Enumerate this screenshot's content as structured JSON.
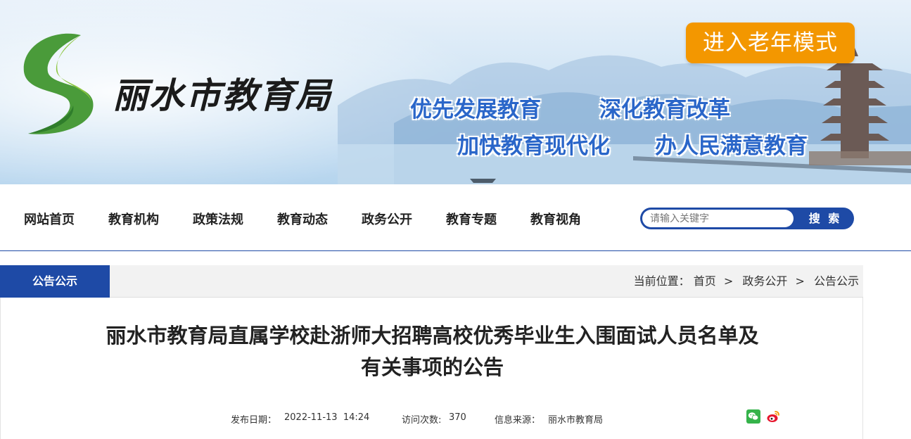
{
  "header": {
    "site_title": "丽水市教育局",
    "slogans": [
      "优先发展教育",
      "深化教育改革",
      "加快教育现代化",
      "办人民满意教育"
    ],
    "elder_mode_label": "进入老年模式",
    "colors": {
      "elder_button": "#f39700",
      "slogan": "#2a66c9"
    }
  },
  "nav": {
    "items": [
      "网站首页",
      "教育机构",
      "政策法规",
      "教育动态",
      "政务公开",
      "教育专题",
      "教育视角"
    ],
    "search": {
      "placeholder": "请输入关键字",
      "button_label": "搜 索"
    },
    "colors": {
      "accent": "#1e4aa6"
    }
  },
  "section": {
    "tab_label": "公告公示",
    "breadcrumb": {
      "prefix": "当前位置：",
      "items": [
        "首页",
        "政务公开",
        "公告公示"
      ],
      "separator": ">"
    }
  },
  "article": {
    "title_line1": "丽水市教育局直属学校赴浙师大招聘高校优秀毕业生入围面试人员名单及",
    "title_line2": "有关事项的公告",
    "meta": {
      "date_label": "发布日期：",
      "date": "2022-11-13  14:24",
      "views_label": "访问次数:",
      "views": "370",
      "source_label": "信息来源：",
      "source": "丽水市教育局"
    },
    "share_icons": [
      "wechat-icon",
      "weibo-icon"
    ]
  }
}
